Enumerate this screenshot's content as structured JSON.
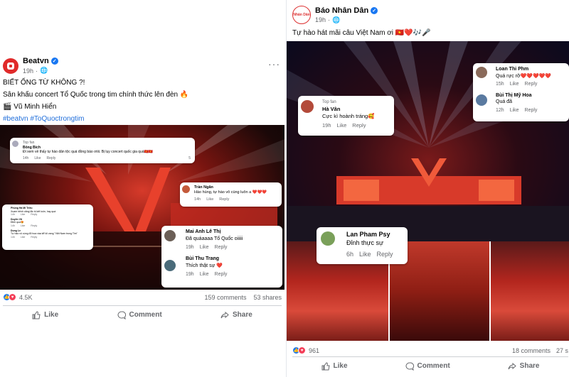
{
  "left_post": {
    "page_name": "Beatvn",
    "time": "19h",
    "caption_line1": "BIẾT ỐNG TỪ KHÔNG ?!",
    "caption_line2": "Sân khấu concert Tổ Quốc trong tim chính thức lên đèn 🔥",
    "caption_line3": "🎬 Vũ Minh Hiển",
    "hashtags": "#beatvn #ToQuoctrongtim",
    "comments": [
      {
        "badge": "Top fan",
        "name": "Bông Bích",
        "text": "Đi xem về thấy tự hào dân tộc quá đồng bào ơiiii. Bị lụy concert quốc gia quá🇻🇳🇻🇳",
        "time": "14h",
        "like": "Like",
        "reply": "Reply",
        "count": "5"
      },
      {
        "name": "Trần Ngân",
        "text": "Hào hùng, tự hào vô cùng luôn a ❤️❤️❤️",
        "time": "14h",
        "like": "Like",
        "reply": "Reply"
      },
      {
        "name": "Phùng Hà Mi Triều",
        "text": "Xuam hênh căng lắc bị kết luôn, hay quá",
        "time": "14h",
        "like": "Like",
        "reply": "Reply"
      },
      {
        "name": "Duyên Vũ",
        "text": "Đỉnh quá😍",
        "time": "14h",
        "like": "Like",
        "reply": "Reply"
      },
      {
        "name": "Dung Le",
        "text": "Tự hào vô cùng đỏ hoa vàa kể lối vang \"Việt Nam trong Tim\"",
        "time": "14h",
        "like": "Like",
        "reply": "Reply"
      },
      {
        "name": "Mai Anh Lê Thị",
        "text": "Đã quáaaaa Tổ Quốc oiiiii",
        "time": "19h",
        "like": "Like",
        "reply": "Reply"
      },
      {
        "name": "Bùi Thu Trang",
        "text": "Thích thật sự ❤️",
        "time": "19h",
        "like": "Like",
        "reply": "Reply"
      }
    ],
    "reaction_count": "4.5K",
    "comments_count": "159 comments",
    "shares_count": "53 shares",
    "like_label": "Like",
    "comment_label": "Comment",
    "share_label": "Share"
  },
  "right_post": {
    "page_name": "Báo Nhân Dân",
    "avatar_text": "Nhân Dân",
    "time": "19h",
    "caption": "Tự hào hát mãi câu Việt Nam ơi 🇻🇳❤️🎶🎤",
    "comments": [
      {
        "badge": "Top fan",
        "name": "Hà Vân",
        "text": "Cực kì hoành tráng🥰",
        "time": "19h",
        "like": "Like",
        "reply": "Reply"
      },
      {
        "name": "Loan Thi Phm",
        "text": "Quá rực rỡ❤️❤️❤️❤️❤️",
        "time": "15h",
        "like": "Like",
        "reply": "Reply"
      },
      {
        "name": "Bùi Thị Mỹ Hoa",
        "text": "Quá đã",
        "time": "12h",
        "like": "Like",
        "reply": "Reply"
      },
      {
        "name": "Lan Pham Psy",
        "text": "Đỉnh thực sự",
        "time": "6h",
        "like": "Like",
        "reply": "Reply"
      }
    ],
    "reaction_count": "961",
    "comments_count": "18 comments",
    "shares_count": "27 s",
    "like_label": "Like",
    "comment_label": "Comment",
    "share_label": "Share"
  },
  "colors": {
    "facebook_blue": "#1877f2",
    "love_red": "#f33e58",
    "hashtag": "#216fdb"
  }
}
